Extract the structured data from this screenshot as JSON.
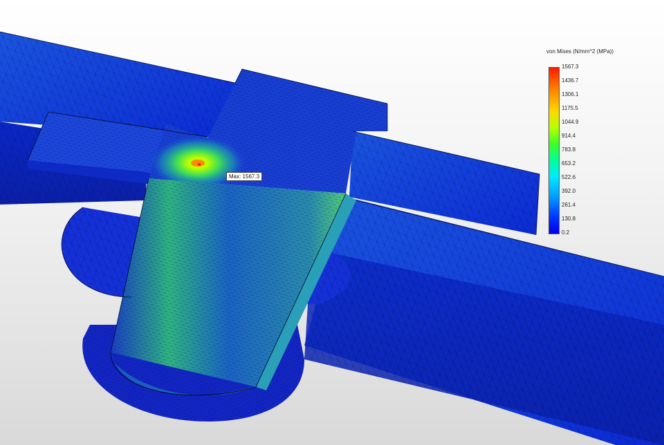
{
  "legend": {
    "title": "von Mises (N/mm^2 (MPa))",
    "ticks": [
      "1567.3",
      "1436.7",
      "1306.1",
      "1175.5",
      "1044.9",
      "914.4",
      "783.8",
      "653.2",
      "522.6",
      "392.0",
      "261.4",
      "130.8",
      "0.2"
    ],
    "colors": {
      "max": "#ff1a00",
      "high": "#ffd800",
      "mid": "#3cff2a",
      "low_mid": "#00e8ff",
      "min": "#0000ee"
    }
  },
  "max_marker": {
    "label": "Max: 1567.3"
  },
  "model": {
    "mesh_color": "#0a0a3a",
    "base_color": "#1230d8",
    "stress_color": "#36c07a"
  }
}
